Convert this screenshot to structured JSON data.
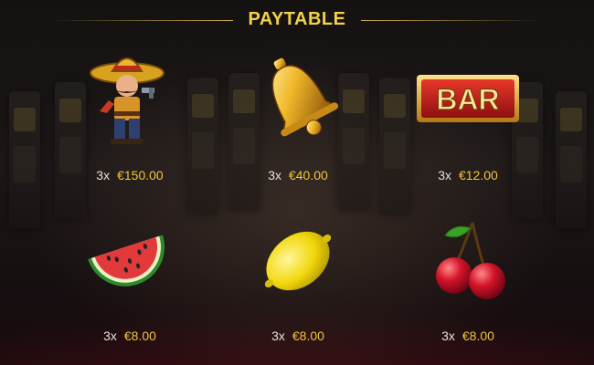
{
  "header": {
    "title": "PAYTABLE"
  },
  "paytable": [
    {
      "symbol": "bandit-icon",
      "multiplier": "3x",
      "amount": "€150.00"
    },
    {
      "symbol": "bell-icon",
      "multiplier": "3x",
      "amount": "€40.00"
    },
    {
      "symbol": "bar-icon",
      "multiplier": "3x",
      "amount": "€12.00",
      "label": "BAR"
    },
    {
      "symbol": "watermelon-icon",
      "multiplier": "3x",
      "amount": "€8.00"
    },
    {
      "symbol": "lemon-icon",
      "multiplier": "3x",
      "amount": "€8.00"
    },
    {
      "symbol": "cherry-icon",
      "multiplier": "3x",
      "amount": "€8.00"
    }
  ],
  "colors": {
    "title": "#f3d24a",
    "amount": "#f0c63a",
    "multiplier": "#e8e2d8"
  }
}
